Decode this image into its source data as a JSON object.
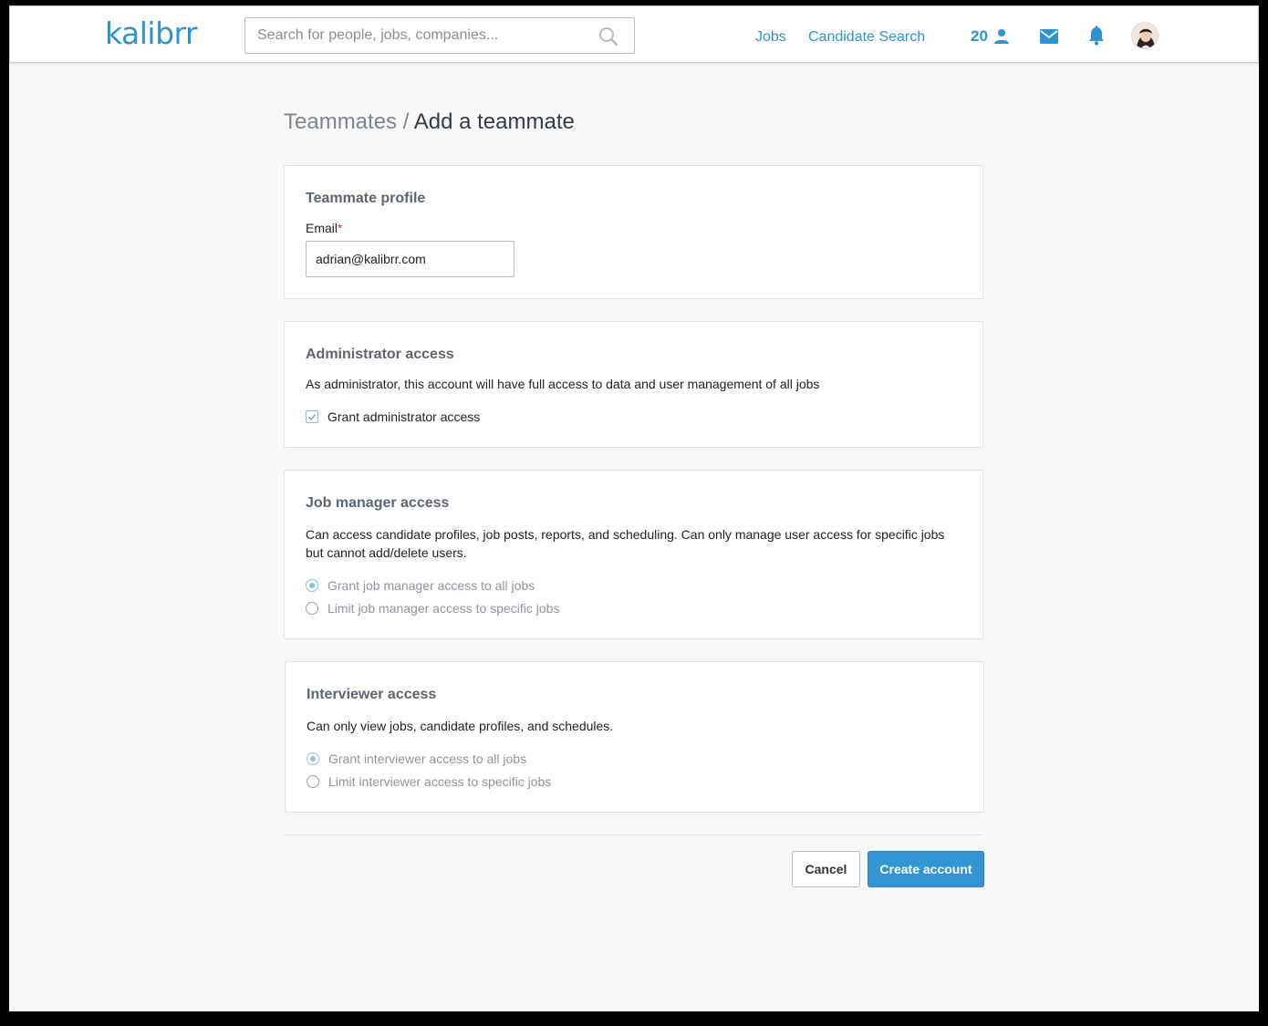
{
  "brand": {
    "logo": "kalibrr",
    "accent": "#2d94d0"
  },
  "header": {
    "search_placeholder": "Search for people, jobs, companies...",
    "nav": {
      "jobs": "Jobs",
      "candidate_search": "Candidate Search"
    },
    "seat_count": "20",
    "icons": [
      "search-icon",
      "person-icon",
      "mail-icon",
      "bell-icon"
    ]
  },
  "page": {
    "breadcrumb_parent": "Teammates",
    "breadcrumb_sep": "/",
    "title": "Add a teammate"
  },
  "profile": {
    "title": "Teammate profile",
    "email_label": "Email",
    "required_mark": "*",
    "email_value": "adrian@kalibrr.com"
  },
  "admin": {
    "title": "Administrator access",
    "description": "As administrator, this account will have full access to data and user management of all jobs",
    "checkbox_label": "Grant administrator access",
    "checked": true
  },
  "job_manager": {
    "title": "Job manager access",
    "description": "Can access candidate profiles, job posts, reports, and scheduling. Can only manage user access for specific jobs but cannot add/delete users.",
    "options": [
      "Grant job manager access to all jobs",
      "Limit job manager access to specific jobs"
    ],
    "selected": 0
  },
  "interviewer": {
    "title": "Interviewer access",
    "description": "Can only view jobs, candidate profiles, and schedules.",
    "options": [
      "Grant interviewer access to all jobs",
      "Limit interviewer access to specific jobs"
    ],
    "selected": 0
  },
  "actions": {
    "cancel": "Cancel",
    "create": "Create account"
  }
}
